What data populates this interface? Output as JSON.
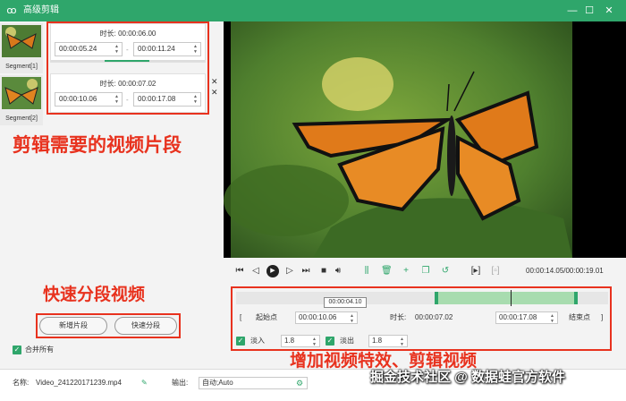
{
  "window": {
    "title": "高级剪辑",
    "app_icon": "rabbit-icon",
    "controls": {
      "minimize": "—",
      "maximize": "☐",
      "close": "✕"
    },
    "accent_color": "#2fa66b"
  },
  "segments": [
    {
      "label": "Segment[1]",
      "duration_label": "时长:",
      "duration": "00:00:06.00",
      "start": "00:00:05.24",
      "end": "00:00:11.24"
    },
    {
      "label": "Segment[2]",
      "duration_label": "时长:",
      "duration": "00:00:07.02",
      "start": "00:00:10.06",
      "end": "00:00:17.08"
    }
  ],
  "annotations": {
    "clips": "剪辑需要的视频片段",
    "split": "快速分段视频",
    "effects": "增加视频特效、剪辑视频",
    "color": "#e8321e"
  },
  "buttons": {
    "add_segment": "新增片段",
    "quick_split": "快速分段"
  },
  "merge_all": {
    "label": "合并所有",
    "checked": true
  },
  "player": {
    "timecode": "00:00:14.05/00:00:19.01",
    "tooltip": "00:00:04.10"
  },
  "trim": {
    "start_label": "起始点",
    "start_value": "00:00:10.06",
    "duration_label": "时长:",
    "duration_value": "00:00:07.02",
    "end_value": "00:00:17.08",
    "end_label": "结束点"
  },
  "fade": {
    "in_label": "淡入",
    "in_value": "1.8",
    "out_label": "淡出",
    "out_value": "1.8"
  },
  "footer": {
    "name_label": "名称:",
    "name_value": "Video_241220171239.mp4",
    "output_label": "输出:",
    "output_value": "自动;Auto"
  },
  "watermark": "掘金技术社区 @ 数据蛙官方软件"
}
